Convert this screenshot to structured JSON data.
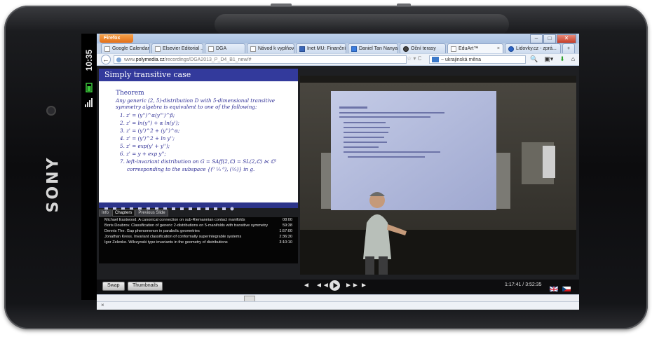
{
  "device": {
    "brand": "SONY",
    "status_time": "10:35"
  },
  "browser": {
    "app_button": "Firefox",
    "window_controls": [
      "–",
      "□",
      "✕"
    ],
    "tabs": [
      {
        "label": "Google Calendar",
        "active": false
      },
      {
        "label": "Elsevier Editorial ...",
        "active": false
      },
      {
        "label": "DGA",
        "active": false
      },
      {
        "label": "Návod k vyplňov...",
        "active": false
      },
      {
        "label": "Inet MU: Finanční...",
        "active": false
      },
      {
        "label": "Daniel Tan Nanya...",
        "active": false
      },
      {
        "label": "Oční terasy",
        "active": false
      },
      {
        "label": "EduArt™",
        "active": true
      },
      {
        "label": "Lidovky.cz - zprá...",
        "active": false
      }
    ],
    "new_tab": "+",
    "url_prefix": "www.",
    "url_domain": "polymedia.cz",
    "url_path": "/recordings/DGA2013_P_D4_B1_new/#",
    "search_text": "~ ukrajinská měna",
    "nav_back": "←",
    "url_icons": "☆ ▾ C",
    "nav_icons": [
      "🔍",
      "▣▾",
      "⬇",
      "⌂"
    ]
  },
  "slide": {
    "title": "Simply transitive case",
    "theorem_heading": "Theorem",
    "statement": "Any generic (2, 5)-distribution D with 5-dimensional transitive symmetry algebra is equivalent to one of the following:",
    "items": [
      "1. z' = (y'')^α(y''')^β;",
      "2. z' = ln(y'') + α ln(y');",
      "3. z' = (y')^2 + (y'')^α;",
      "4. z' = (y')^2 + ln y'';",
      "5. z' = exp(y' + y'');",
      "6. z' = y + exp y'';",
      "7. left-invariant distribution on G = SAff(2,ℂ) = SL(2,ℂ) ⋉ ℂ²"
    ],
    "item7_cont": "corresponding to the subspace {(⁰ ¹⁄₀ ⁰), (¹⁄₀)} in g."
  },
  "info_tabs": [
    "Info",
    "Chapters",
    "Previous Slide"
  ],
  "chapters": [
    {
      "title": "Michael Eastwood. A canonical connection on sub-Riemannian contact manifolds",
      "time": "08:00"
    },
    {
      "title": "Boris Doubrov. Classification of generic 2-distributions on 5-manifolds with transitive symmetry",
      "time": "59:38"
    },
    {
      "title": "Dennis The. Gap phenomenon in parabolic geometries",
      "time": "1:57:00"
    },
    {
      "title": "Jonathan Kress. Invariant classification of conformally superintegrable systems",
      "time": "2:36:30"
    },
    {
      "title": "Igor Zelenko. Wilczynski type invariants in the geometry of distributions",
      "time": "3:10:10"
    }
  ],
  "controls": {
    "swap": "Swap",
    "thumbnails": "Thumbnails",
    "rewind_icon": "◄",
    "back_icon": "◄◄",
    "forward_icon": "►►",
    "next_icon": "►",
    "time": "1:17:41 / 3:52:35"
  },
  "findbar_close": "×",
  "colors": {
    "slide_title_bg": "#333a9c",
    "slide_text": "#2d2d95",
    "player_bg": "#0d0d0f"
  }
}
